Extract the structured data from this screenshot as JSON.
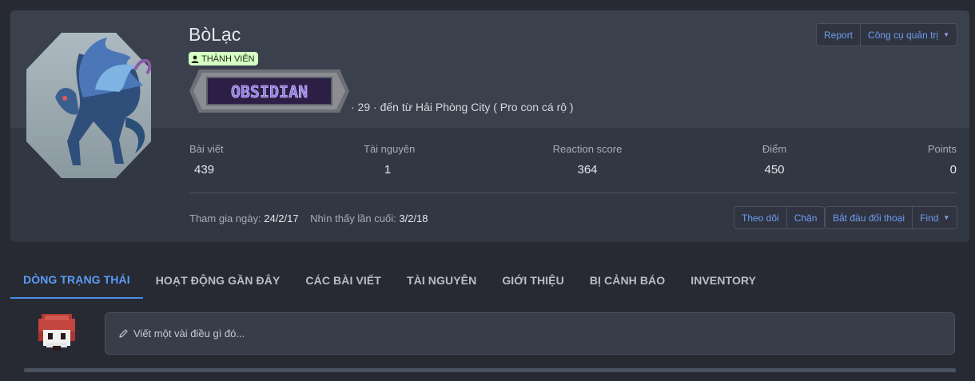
{
  "profile": {
    "username": "BòLạc",
    "role": "THÀNH VIÊN",
    "banner_text": "OBSIDIAN",
    "meta": "· 29 · đến từ Hải Phòng City ( Pro con cá rộ )"
  },
  "actions_top": {
    "report": "Report",
    "admin_tools": "Công cụ quản trị"
  },
  "stats": [
    {
      "label": "Bài viết",
      "value": "439"
    },
    {
      "label": "Tài nguyên",
      "value": "1"
    },
    {
      "label": "Reaction score",
      "value": "364"
    },
    {
      "label": "Điểm",
      "value": "450"
    },
    {
      "label": "Points",
      "value": "0"
    }
  ],
  "joined": {
    "label": "Tham gia ngày:",
    "value": "24/2/17"
  },
  "last_seen": {
    "label": "Nhìn thấy lần cuối:",
    "value": "3/2/18"
  },
  "actions_bottom": {
    "follow": "Theo dõi",
    "block": "Chặn",
    "start_conversation": "Bắt đầu đối thoại",
    "find": "Find"
  },
  "tabs": [
    "DÒNG TRẠNG THÁI",
    "HOẠT ĐỘNG GẦN ĐÂY",
    "CÁC BÀI VIẾT",
    "TÀI NGUYÊN",
    "GIỚI THIỆU",
    "BỊ CẢNH BÁO",
    "INVENTORY"
  ],
  "status_box": {
    "placeholder": "Viết một vài điều gì đó..."
  },
  "colors": {
    "accent": "#5b9cf5",
    "badge_bg": "#d5ffc4",
    "card_bg": "#323744",
    "page_bg": "#272a33"
  }
}
